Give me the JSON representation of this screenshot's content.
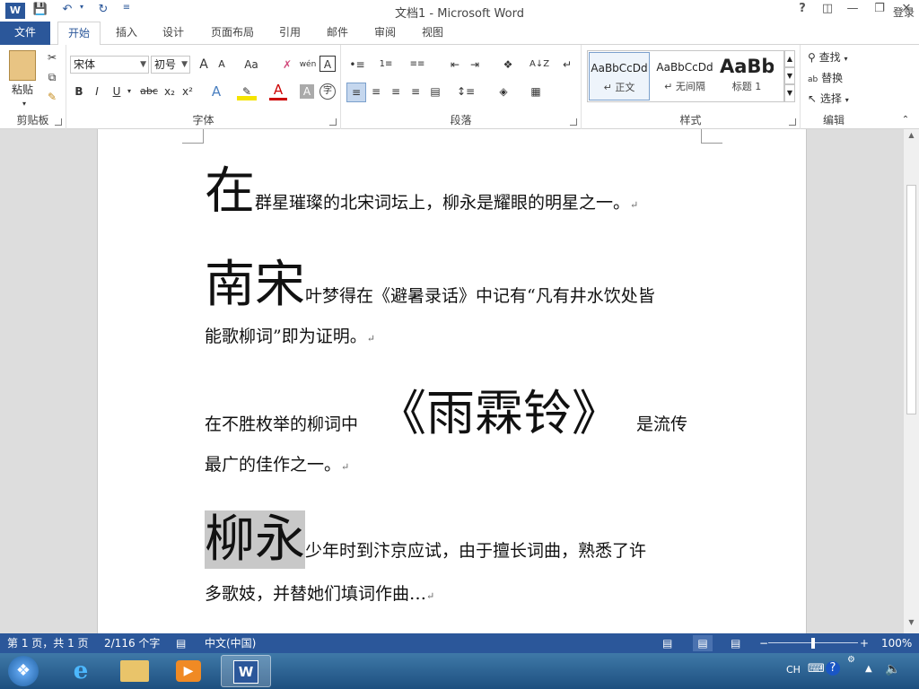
{
  "titlebar": {
    "title": "文档1 - Microsoft Word",
    "help": "?",
    "login": "登录"
  },
  "tabs": [
    {
      "label": "文件"
    },
    {
      "label": "开始"
    },
    {
      "label": "插入"
    },
    {
      "label": "设计"
    },
    {
      "label": "页面布局"
    },
    {
      "label": "引用"
    },
    {
      "label": "邮件"
    },
    {
      "label": "审阅"
    },
    {
      "label": "视图"
    }
  ],
  "ribbon": {
    "clipboard": {
      "label": "剪贴板",
      "paste": "粘贴"
    },
    "font": {
      "label": "字体",
      "font_name": "宋体",
      "font_size": "初号",
      "bold": "B",
      "italic": "I",
      "underline": "U",
      "strike": "abc",
      "sub": "x₂",
      "sup": "x²",
      "grow": "A",
      "shrink": "A",
      "case": "Aa",
      "pinyin": "wén",
      "charborder": "A",
      "effects": "A",
      "color": "A",
      "shade": "A",
      "circle": "字"
    },
    "paragraph": {
      "label": "段落"
    },
    "styles": {
      "label": "样式",
      "items": [
        {
          "preview": "AaBbCcDd",
          "name": "↵ 正文"
        },
        {
          "preview": "AaBbCcDd",
          "name": "↵ 无间隔"
        },
        {
          "preview": "AaBb",
          "name": "标题 1"
        }
      ]
    },
    "editing": {
      "label": "编辑",
      "find": "查找",
      "replace": "替换",
      "select": "选择"
    }
  },
  "document": {
    "paragraphs": [
      {
        "big": "在",
        "text": "群星璀璨的北宋词坛上，柳永是耀眼的明星之一。"
      },
      {
        "big": "南宋",
        "text": "叶梦得在《避暑录话》中记有“凡有井水饮处皆",
        "line2": "能歌柳词”即为证明。"
      },
      {
        "pre": "在不胜枚举的柳词中",
        "big": "《雨霖铃》",
        "text": "是流传",
        "line2": "最广的佳作之一。"
      },
      {
        "big": "柳永",
        "text": "少年时到汴京应试，由于擅长词曲，熟悉了许",
        "line2": "多歌妓，并替她们填词作曲…"
      }
    ],
    "paragraph_mark": "↵"
  },
  "statusbar": {
    "page": "第 1 页，共 1 页",
    "words": "2/116 个字",
    "language": "中文(中国)",
    "zoom": "100%",
    "zoom_level": 1.0
  },
  "taskbar": {
    "ime": "CH",
    "apps": [
      "start",
      "ie",
      "explorer",
      "media-player",
      "word"
    ]
  },
  "colors": {
    "accent": "#2b579a",
    "highlight": "#c8c8c8"
  }
}
